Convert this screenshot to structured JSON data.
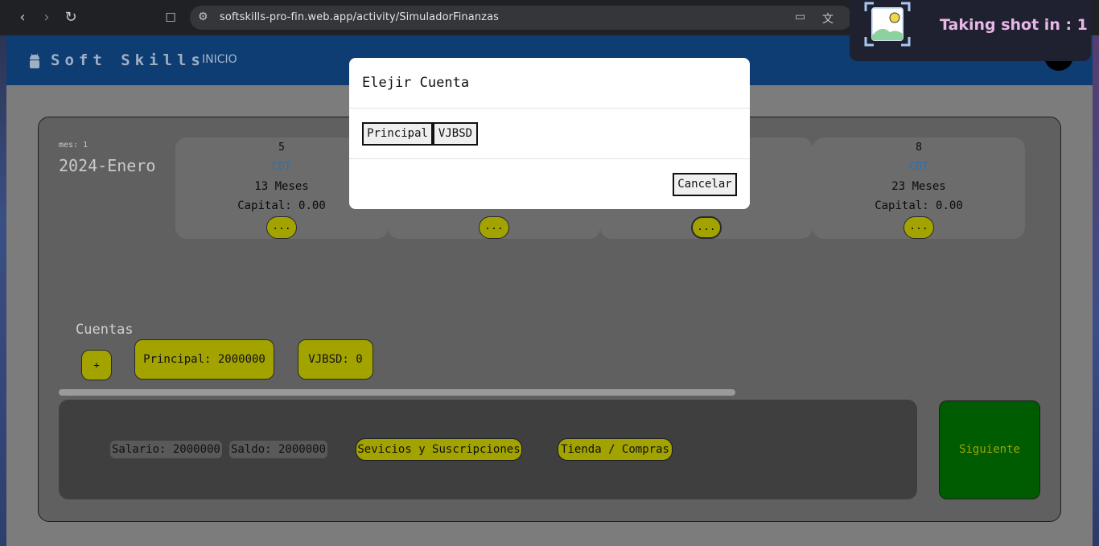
{
  "browser": {
    "url": "softskills-pro-fin.web.app/activity/SimuladorFinanzas"
  },
  "app": {
    "logo": "Soft Skills",
    "nav_inicio": "INICIO"
  },
  "period": {
    "mes_label": "mes: 1",
    "fecha": "2024-Enero"
  },
  "cards": [
    {
      "num": "5",
      "type": "CDT",
      "meses": "13 Meses",
      "capital": "Capital: 0.00",
      "more": "..."
    },
    {
      "more": "..."
    },
    {
      "more": "..."
    },
    {
      "num": "8",
      "type": "CDT",
      "meses": "23 Meses",
      "capital": "Capital: 0.00",
      "more": "..."
    }
  ],
  "cuentas": {
    "title": "Cuentas",
    "add_label": "+",
    "accounts": [
      {
        "label": "Principal: 2000000"
      },
      {
        "label": "VJBSD: 0"
      }
    ]
  },
  "footer": {
    "salario": "Salario: 2000000",
    "saldo": "Saldo: 2000000",
    "servicios": "Sevicios y Suscripciones",
    "tienda": "Tienda / Compras",
    "siguiente": "Siguiente"
  },
  "modal": {
    "title": "Elejir Cuenta",
    "options": [
      "Principal",
      "VJBSD"
    ],
    "cancel": "Cancelar"
  },
  "toast": {
    "text": "Taking shot in : 1"
  },
  "colors": {
    "appbar": "#0d3d73",
    "accent_button": "#a3a300",
    "next_button": "#005c00",
    "cdt_text": "#2e6fb0"
  }
}
